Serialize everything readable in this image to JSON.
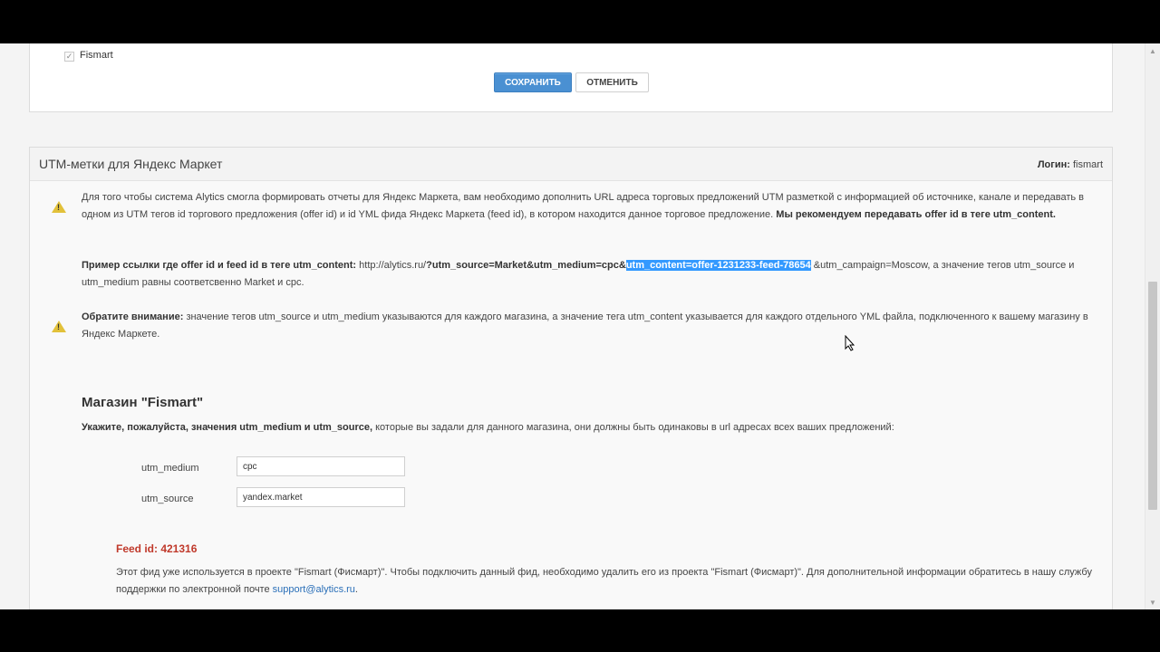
{
  "top_panel": {
    "checkbox_label": "Fismart",
    "save_label": "СОХРАНИТЬ",
    "cancel_label": "ОТМЕНИТЬ"
  },
  "main_panel": {
    "title": "UTM-метки для Яндекс Маркет",
    "login_label": "Логин:",
    "login_value": "fismart"
  },
  "info": {
    "p1_text": "Для того чтобы система Alytics смогла формировать отчеты для Яндекс Маркета, вам необходимо дополнить URL адреса торговых предложений UTM разметкой с информацией об источнике, канале и передавать в одном из UTM тегов id торгового предложения (offer id) и id YML фида Яндекс Маркета (feed id), в котором находится данное торговое предложение.",
    "p1_bold": "Мы рекомендуем передавать offer id в теге utm_content.",
    "example_bold": "Пример ссылки где offer id и feed id в теге utm_content:",
    "example_url_start": "http://alytics.ru/",
    "example_url_bold": "?utm_source=Market&utm_medium=cpc&",
    "example_highlight": "utm_content=offer-1231233-feed-78654",
    "example_url_end": "&utm_campaign=Moscow, а значение тегов utm_source и utm_medium равны соответсвенно Market и cpc.",
    "notice_bold": "Обратите внимание:",
    "notice_text": "значение тегов utm_source и utm_medium указываются для каждого магазина, а значение тега utm_content указывается для каждого отдельного YML файла, подключенного к вашему магазину в Яндекс Маркете."
  },
  "shop": {
    "title": "Магазин \"Fismart\"",
    "desc_bold": "Укажите, пожалуйста, значения utm_medium и utm_source,",
    "desc_text": "которые вы задали для данного магазина, они должны быть одинаковы в url адресах всех ваших предложений:",
    "medium_label": "utm_medium",
    "medium_value": "cpc",
    "source_label": "utm_source",
    "source_value": "yandex.market"
  },
  "feed": {
    "label": "Feed id: 421316",
    "message": "Этот фид уже используется в проекте \"Fismart (Фисмарт)\". Чтобы подключить данный фид, необходимо удалить его из проекта \"Fismart (Фисмарт)\". Для дополнительной информации обратитесь в нашу службу поддержки по электронной почте",
    "email": "support@alytics.ru",
    "suffix": "."
  },
  "icons": [
    "warning-icon",
    "check-icon",
    "cursor-icon"
  ],
  "colors": {
    "primary": "#4a90d2",
    "warning": "#e2c13a",
    "error": "#c0392b",
    "selection": "#3399ff"
  }
}
